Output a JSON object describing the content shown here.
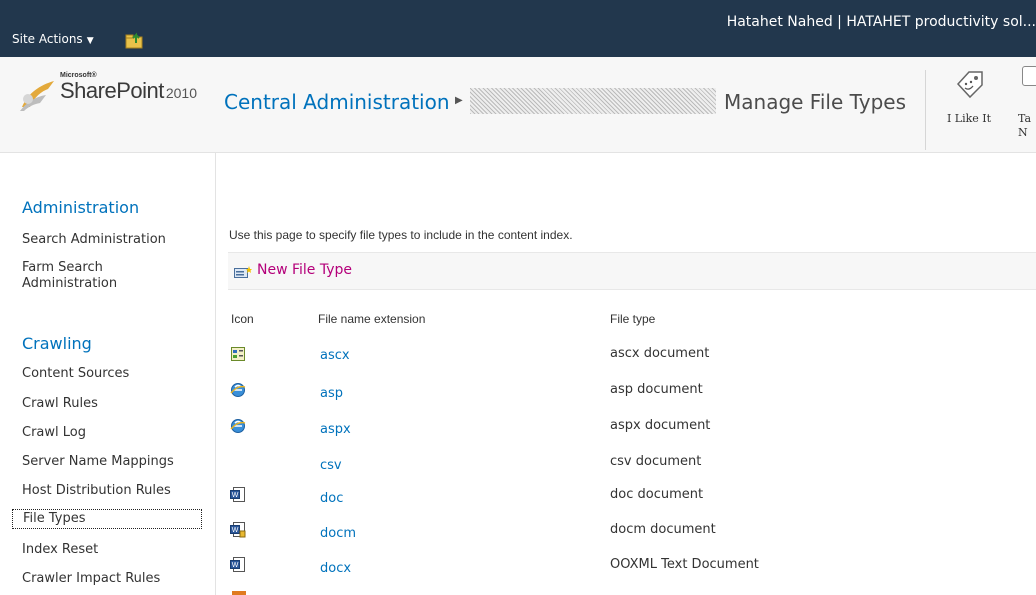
{
  "topbar": {
    "site_actions_label": "Site Actions",
    "user_text": "Hatahet Nahed | HATAHET productivity sol..."
  },
  "header": {
    "brand_microsoft": "Microsoft®",
    "brand_product": "SharePoint",
    "brand_version": "2010",
    "breadcrumb_root": "Central Administration",
    "page_title": "Manage File Types",
    "like_label": "I Like It",
    "tags_label": "Ta\nN"
  },
  "leftnav": {
    "sections": [
      {
        "heading": "Administration",
        "items": [
          "Search Administration",
          "Farm Search Administration"
        ]
      },
      {
        "heading": "Crawling",
        "items": [
          "Content Sources",
          "Crawl Rules",
          "Crawl Log",
          "Server Name Mappings",
          "Host Distribution Rules",
          "File Types",
          "Index Reset",
          "Crawler Impact Rules"
        ]
      }
    ],
    "selected": "File Types"
  },
  "main": {
    "intro": "Use this page to specify file types to include in the content index.",
    "new_file_type_label": "New File Type",
    "columns": {
      "icon": "Icon",
      "extension": "File name extension",
      "type": "File type"
    },
    "rows": [
      {
        "icon": "ascx-file-icon",
        "ext": "ascx",
        "type": "ascx document"
      },
      {
        "icon": "ie-globe-icon",
        "ext": "asp",
        "type": "asp document"
      },
      {
        "icon": "ie-globe-icon",
        "ext": "aspx",
        "type": "aspx document"
      },
      {
        "icon": "",
        "ext": "csv",
        "type": "csv document"
      },
      {
        "icon": "word-doc-icon",
        "ext": "doc",
        "type": "doc document"
      },
      {
        "icon": "word-docm-icon",
        "ext": "docm",
        "type": "docm document"
      },
      {
        "icon": "word-doc-icon",
        "ext": "docx",
        "type": "OOXML Text Document"
      }
    ]
  }
}
